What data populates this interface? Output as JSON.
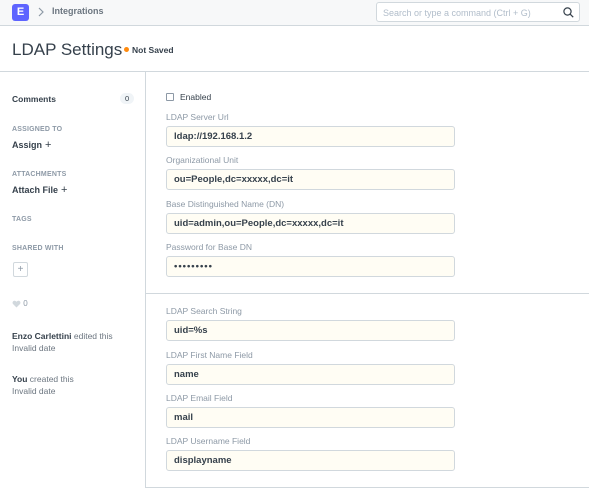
{
  "navbar": {
    "logo_letter": "E",
    "breadcrumb": "Integrations",
    "search_placeholder": "Search or type a command (Ctrl + G)"
  },
  "page": {
    "title": "LDAP Settings",
    "status": "Not Saved",
    "status_color": "#ff8b0f"
  },
  "sidebar": {
    "comments_label": "Comments",
    "comments_count": "0",
    "assigned_to_label": "ASSIGNED TO",
    "assign_action": "Assign",
    "attachments_label": "ATTACHMENTS",
    "attach_action": "Attach File",
    "tags_label": "TAGS",
    "shared_with_label": "SHARED WITH",
    "likes_count": "0",
    "timeline": [
      {
        "user": "Enzo Carlettini",
        "text": " edited this",
        "date": "Invalid date"
      },
      {
        "user": "You",
        "text": " created this",
        "date": "Invalid date"
      }
    ]
  },
  "form": {
    "enabled_label": "Enabled",
    "fields": [
      {
        "label": "LDAP Server Url",
        "value": "ldap://192.168.1.2"
      },
      {
        "label": "Organizational Unit",
        "value": "ou=People,dc=xxxxx,dc=it"
      },
      {
        "label": "Base Distinguished Name (DN)",
        "value": "uid=admin,ou=People,dc=xxxxx,dc=it"
      },
      {
        "label": "Password for Base DN",
        "value": "•••••••••"
      },
      {
        "label": "LDAP Search String",
        "value": "uid=%s"
      },
      {
        "label": "LDAP First Name Field",
        "value": "name"
      },
      {
        "label": "LDAP Email Field",
        "value": "mail"
      },
      {
        "label": "LDAP Username Field",
        "value": "displayname"
      }
    ]
  },
  "colors": {
    "accent": "#5e64ff",
    "input_background": "#fffdf4",
    "border": "#d1d8dd"
  }
}
